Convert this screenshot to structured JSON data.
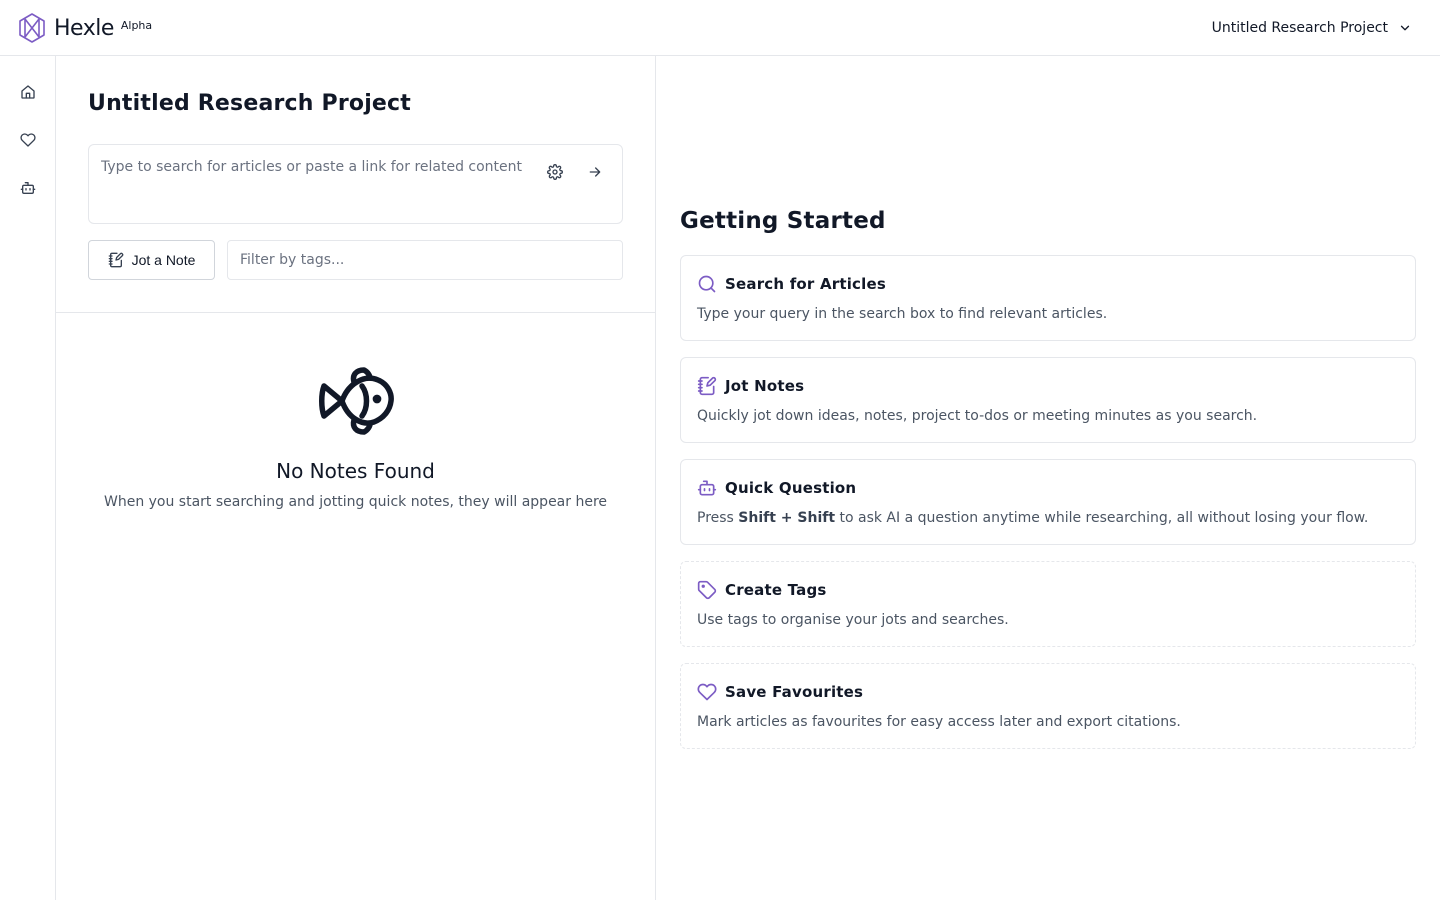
{
  "app": {
    "name": "Hexle",
    "badge": "Alpha",
    "accent_color": "#7c5cc4"
  },
  "header": {
    "project_selector": {
      "label": "Untitled Research Project",
      "icon": "chevron-down-icon"
    }
  },
  "rail": {
    "items": [
      {
        "name": "home",
        "icon": "home-icon"
      },
      {
        "name": "favourites",
        "icon": "heart-icon"
      },
      {
        "name": "ai-assistant",
        "icon": "bot-icon"
      }
    ]
  },
  "main": {
    "title": "Untitled Research Project",
    "search": {
      "placeholder": "Type to search for articles or paste a link for related content",
      "value": "",
      "settings_icon": "gear-icon",
      "submit_icon": "arrow-right-icon"
    },
    "jot_button": {
      "label": "Jot a Note",
      "icon": "notebook-pen-icon"
    },
    "tag_filter": {
      "placeholder": "Filter by tags...",
      "value": ""
    },
    "empty_state": {
      "icon": "fish-icon",
      "title": "No Notes Found",
      "description": "When you start searching and jotting quick notes, they will appear here"
    }
  },
  "getting_started": {
    "title": "Getting Started",
    "cards": [
      {
        "icon": "search-icon",
        "title": "Search for Articles",
        "description": "Type your query in the search box to find relevant articles.",
        "style": "solid"
      },
      {
        "icon": "notebook-pen-icon",
        "title": "Jot Notes",
        "description": "Quickly jot down ideas, notes, project to-dos or meeting minutes as you search.",
        "style": "solid"
      },
      {
        "icon": "bot-icon",
        "title": "Quick Question",
        "description_prefix": "Press ",
        "description_bold": "Shift + Shift",
        "description_suffix": " to ask AI a question anytime while researching, all without losing your flow.",
        "style": "solid"
      },
      {
        "icon": "tag-icon",
        "title": "Create Tags",
        "description": "Use tags to organise your jots and searches.",
        "style": "dashed"
      },
      {
        "icon": "heart-icon",
        "title": "Save Favourites",
        "description": "Mark articles as favourites for easy access later and export citations.",
        "style": "dashed"
      }
    ]
  }
}
